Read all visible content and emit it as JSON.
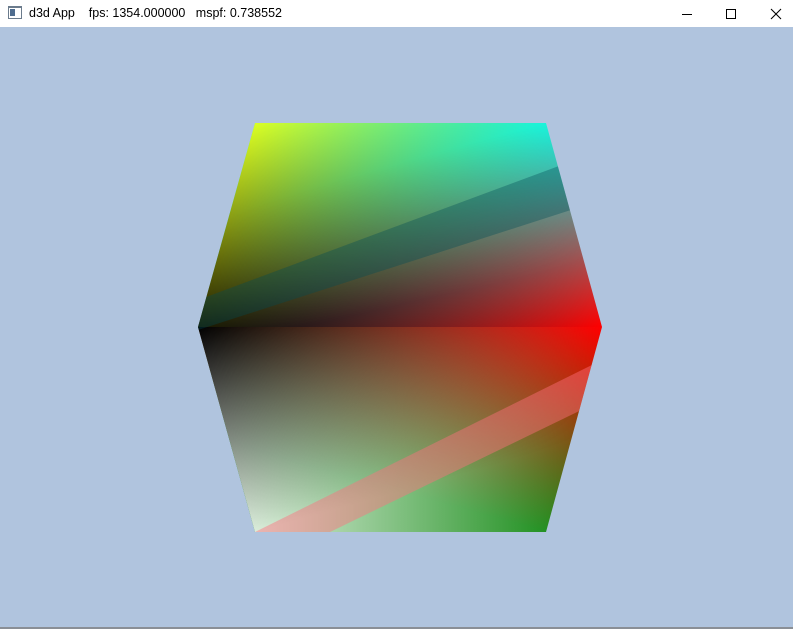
{
  "window": {
    "title": "d3d App    fps: 1354.000000   mspf: 0.738552",
    "background_color": "#b0c4de",
    "icon": "app-window-icon"
  },
  "caption_buttons": [
    {
      "name": "minimize",
      "icon": "minimize-icon"
    },
    {
      "name": "maximize",
      "icon": "maximize-icon"
    },
    {
      "name": "close",
      "icon": "close-icon"
    }
  ],
  "scene": {
    "object": "cube",
    "vertex_colors": [
      "#ffff00",
      "#00ffff",
      "#000000",
      "#ff0000",
      "#ffffff",
      "#008000"
    ]
  }
}
